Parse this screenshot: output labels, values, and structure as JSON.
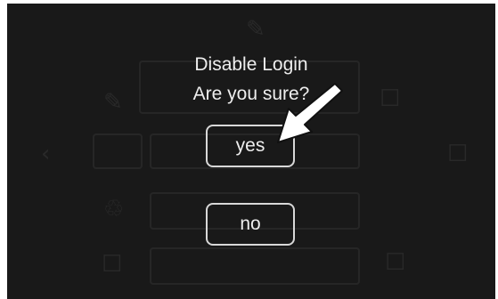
{
  "dialog": {
    "title_line_1": "Disable Login",
    "title_line_2": "Are you sure?",
    "yes_label": "yes",
    "no_label": "no"
  },
  "background": {
    "icons": [
      "pencil-icon",
      "user-icon",
      "chevron-left-icon",
      "trash-icon",
      "trash-icon",
      "checkbox-icon",
      "user-icon"
    ]
  },
  "colors": {
    "panel": "#1d1d1d",
    "text": "#eeeeee",
    "button_border": "#d8d8d8",
    "pointer_arrow": "#ffffff"
  }
}
